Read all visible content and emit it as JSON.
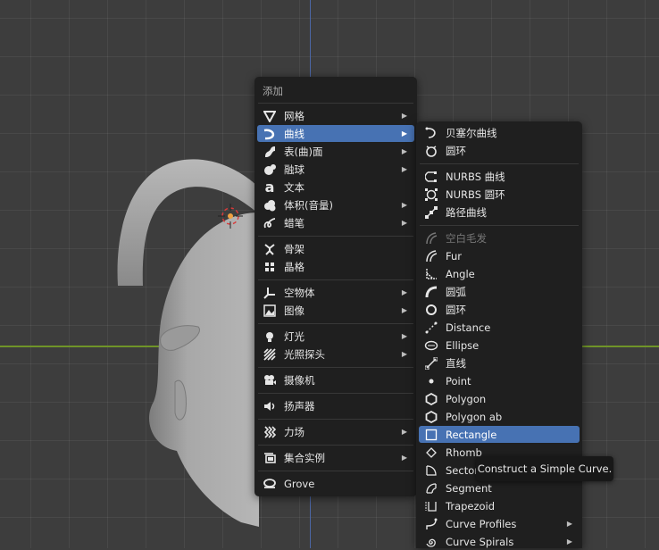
{
  "add_menu": {
    "title": "添加",
    "items": [
      {
        "label": "网格",
        "icon": "mesh-icon",
        "submenu": true
      },
      {
        "label": "曲线",
        "icon": "curve-icon",
        "submenu": true,
        "active": true
      },
      {
        "label": "表(曲)面",
        "icon": "surface-icon",
        "submenu": true
      },
      {
        "label": "融球",
        "icon": "metaball-icon",
        "submenu": true
      },
      {
        "label": "文本",
        "icon": "text-icon",
        "submenu": false
      },
      {
        "label": "体积(音量)",
        "icon": "volume-icon",
        "submenu": true
      },
      {
        "label": "蜡笔",
        "icon": "grease-pencil-icon",
        "submenu": true
      },
      {
        "label": "骨架",
        "icon": "armature-icon",
        "submenu": false
      },
      {
        "label": "晶格",
        "icon": "lattice-icon",
        "submenu": false
      },
      {
        "label": "空物体",
        "icon": "empty-icon",
        "submenu": true
      },
      {
        "label": "图像",
        "icon": "image-icon",
        "submenu": true
      },
      {
        "label": "灯光",
        "icon": "light-icon",
        "submenu": true
      },
      {
        "label": "光照探头",
        "icon": "light-probe-icon",
        "submenu": true
      },
      {
        "label": "摄像机",
        "icon": "camera-icon",
        "submenu": false
      },
      {
        "label": "扬声器",
        "icon": "speaker-icon",
        "submenu": false
      },
      {
        "label": "力场",
        "icon": "force-field-icon",
        "submenu": true
      },
      {
        "label": "集合实例",
        "icon": "collection-instance-icon",
        "submenu": true
      },
      {
        "label": "Grove",
        "icon": "grove-icon",
        "submenu": false
      }
    ]
  },
  "curve_menu": {
    "items": [
      {
        "label": "贝塞尔曲线",
        "icon": "bezier-curve-icon"
      },
      {
        "label": "圆环",
        "icon": "bezier-circle-icon"
      },
      {
        "label": "NURBS 曲线",
        "icon": "nurbs-curve-icon"
      },
      {
        "label": "NURBS 圆环",
        "icon": "nurbs-circle-icon"
      },
      {
        "label": "路径曲线",
        "icon": "path-curve-icon"
      },
      {
        "label": "空白毛发",
        "icon": "empty-hair-icon",
        "disabled": true
      },
      {
        "label": "Fur",
        "icon": "fur-icon"
      },
      {
        "label": "Angle",
        "icon": "angle-icon"
      },
      {
        "label": "圆弧",
        "icon": "arc-icon"
      },
      {
        "label": "圆环",
        "icon": "circle-icon"
      },
      {
        "label": "Distance",
        "icon": "distance-icon"
      },
      {
        "label": "Ellipse",
        "icon": "ellipse-icon"
      },
      {
        "label": "直线",
        "icon": "line-icon"
      },
      {
        "label": "Point",
        "icon": "point-icon"
      },
      {
        "label": "Polygon",
        "icon": "polygon-icon"
      },
      {
        "label": "Polygon ab",
        "icon": "polygon-ab-icon"
      },
      {
        "label": "Rectangle",
        "icon": "rectangle-icon",
        "active": true
      },
      {
        "label": "Rhomb",
        "icon": "rhomb-icon"
      },
      {
        "label": "Sector",
        "icon": "sector-icon"
      },
      {
        "label": "Segment",
        "icon": "segment-icon"
      },
      {
        "label": "Trapezoid",
        "icon": "trapezoid-icon"
      },
      {
        "label": "Curve Profiles",
        "icon": "curve-profiles-icon",
        "submenu": true
      },
      {
        "label": "Curve Spirals",
        "icon": "curve-spirals-icon",
        "submenu": true
      }
    ]
  },
  "tooltip": {
    "text": "Construct a Simple Curve."
  },
  "colors": {
    "highlight": "#4772b3",
    "menu_bg": "#1f1f1f",
    "x_axis": "#6f9428",
    "y_axis": "#4b66a5"
  }
}
